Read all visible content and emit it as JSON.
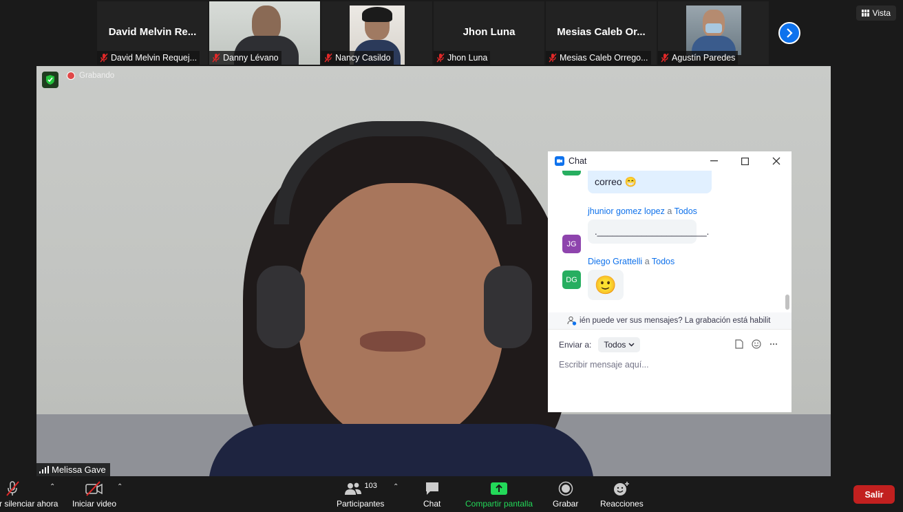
{
  "gallery": {
    "tiles": [
      {
        "big": "David  Melvin  Re...",
        "caption": "David Melvin Requej..."
      },
      {
        "caption": "Danny Lévano"
      },
      {
        "caption": "Nancy Casildo"
      },
      {
        "big": "Jhon Luna",
        "caption": "Jhon Luna"
      },
      {
        "big": "Mesias  Caleb  Or...",
        "caption": "Mesias Caleb Orrego..."
      },
      {
        "caption": "Agustín Paredes"
      }
    ],
    "view_label": "Vista"
  },
  "main_video": {
    "recording_label": "Grabando",
    "speaker_name": "Melissa Gave"
  },
  "chat": {
    "title": "Chat",
    "messages": [
      {
        "text": "correo 😁"
      },
      {
        "sender": "jhunior gomez lopez",
        "to_word": "a",
        "recipient": "Todos",
        "initials": "JG",
        "avatar_color": "#8e44ad",
        "text": ".______________________."
      },
      {
        "sender": "Diego Grattelli",
        "to_word": "a",
        "recipient": "Todos",
        "initials": "DG",
        "avatar_color": "#27ae60",
        "text": "🙂"
      }
    ],
    "notice": "ién puede ver sus mensajes? La grabación está habilit",
    "send_to_label": "Enviar a:",
    "send_to_value": "Todos",
    "input_placeholder": "Escribir mensaje aquí..."
  },
  "toolbar": {
    "unmute": "r silenciar ahora",
    "start_video": "Iniciar video",
    "participants": "Participantes",
    "participants_count": "103",
    "chat": "Chat",
    "share": "Compartir pantalla",
    "record": "Grabar",
    "reactions": "Reacciones",
    "leave": "Salir"
  },
  "colors": {
    "accent": "#0e72ed",
    "share_green": "#23d959",
    "leave_red": "#c2201f",
    "mic_off_red": "#e02828"
  }
}
